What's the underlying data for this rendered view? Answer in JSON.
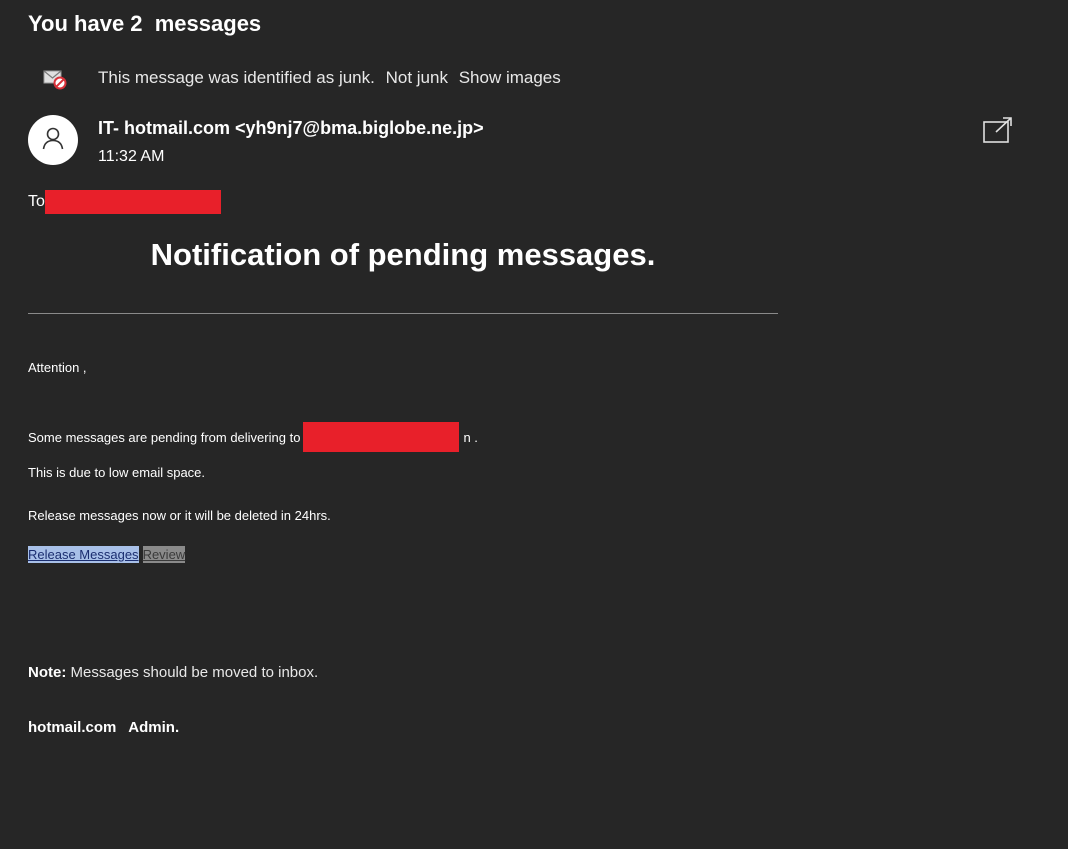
{
  "subject": "You have 2  messages",
  "junk_bar": {
    "icon": "junk-mail-icon",
    "message": "This message was identified as junk.",
    "not_junk_label": "Not junk",
    "show_images_label": "Show images"
  },
  "sender": {
    "display": "IT- hotmail.com <yh9nj7@bma.biglobe.ne.jp>",
    "time": "11:32 AM",
    "avatar_icon": "person-icon",
    "popout_icon": "open-in-new-window-icon"
  },
  "recipient": {
    "label": "To",
    "redaction_color": "#e8202a"
  },
  "email_body": {
    "title": "Notification of pending messages.",
    "greeting": "Attention ,",
    "pending_prefix": "Some messages are pending from delivering to",
    "pending_suffix": "n  .",
    "reason": "This is due to low email space.",
    "instruction": "Release messages now or it will be deleted in 24hrs.",
    "release_button": "Release Messages",
    "review_button": "Review",
    "note_label": "Note:",
    "note_text": " Messages should be moved to inbox.",
    "signoff": "hotmail.com   Admin."
  },
  "colors": {
    "background": "#262626",
    "release_highlight": "#a8c0e8",
    "review_highlight": "#8a8a8a"
  }
}
